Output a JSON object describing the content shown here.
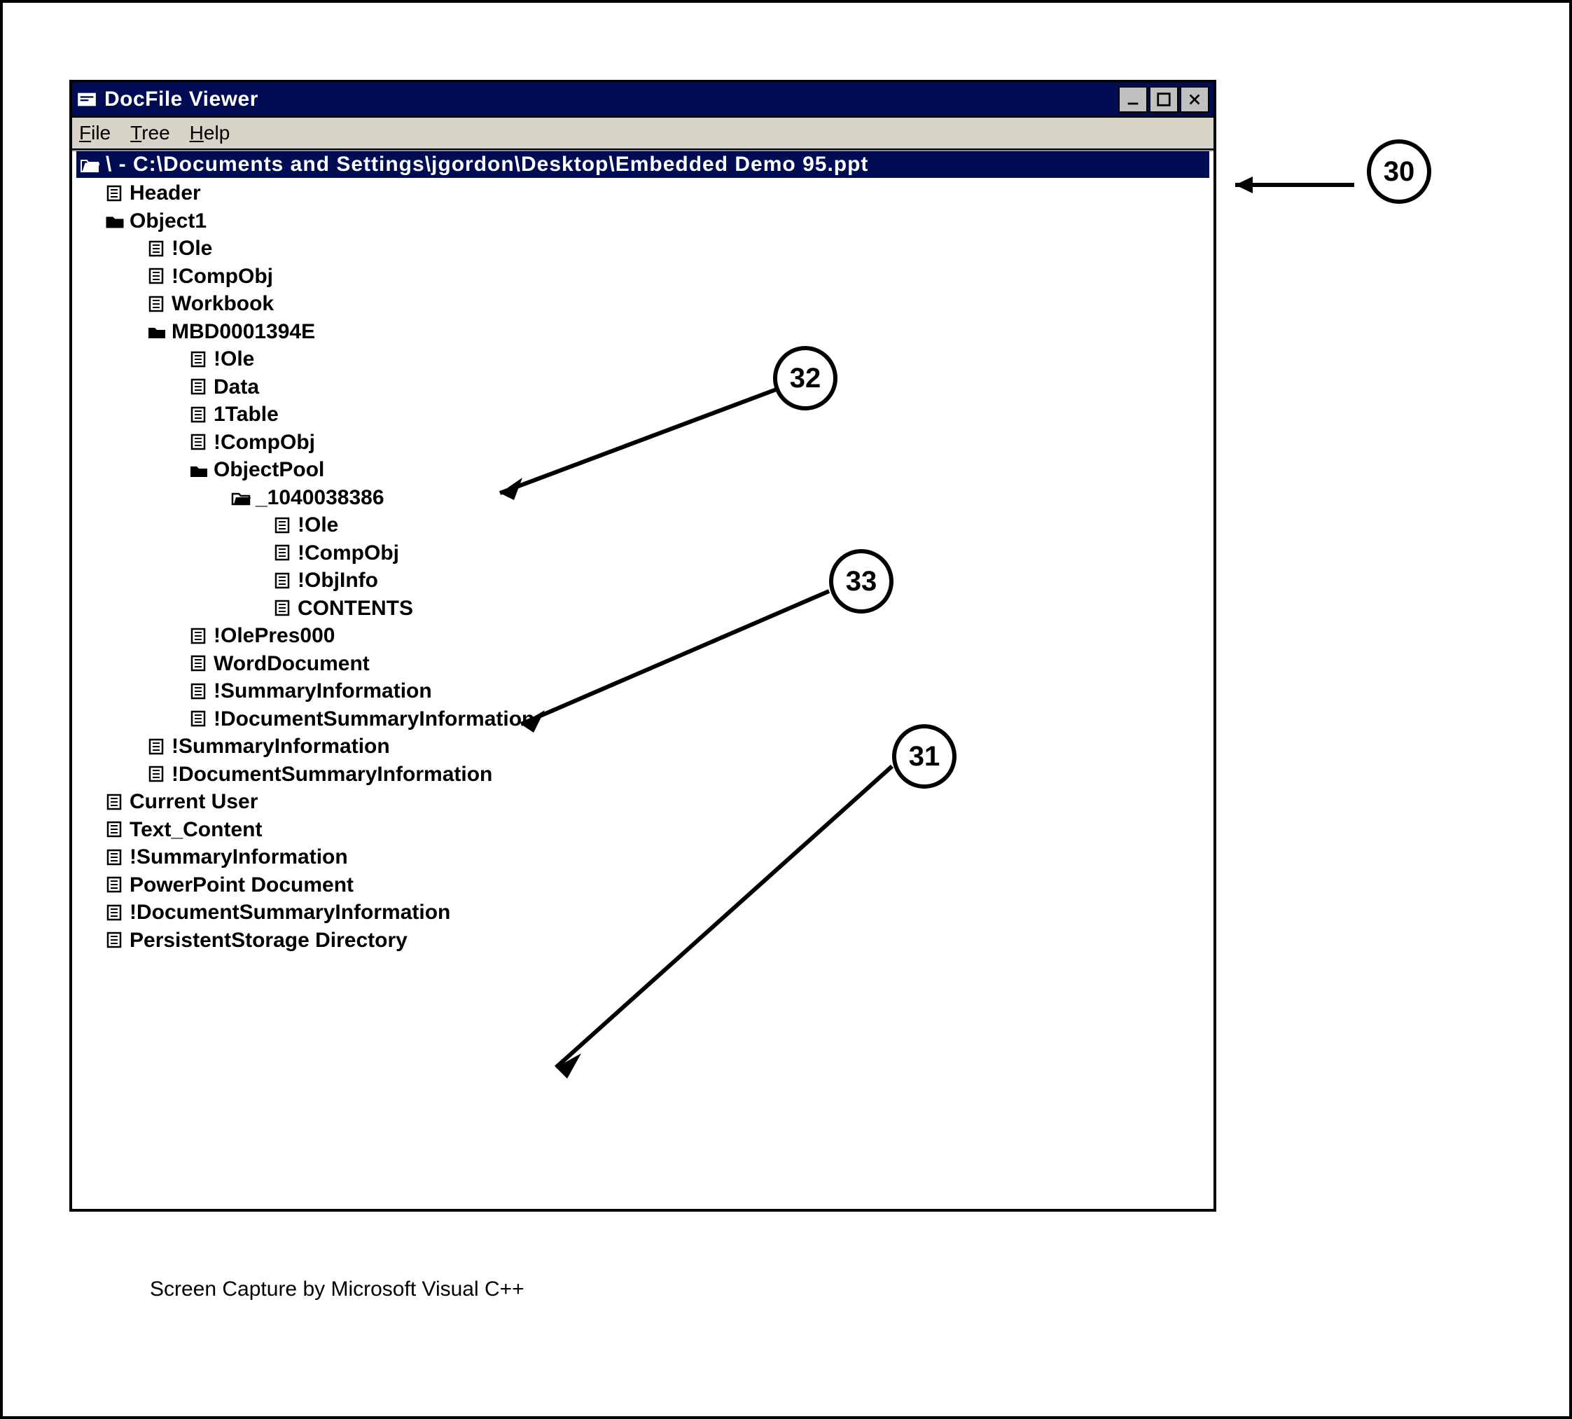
{
  "window": {
    "title": "DocFile Viewer"
  },
  "menu": {
    "file": "File",
    "tree": "Tree",
    "help": "Help"
  },
  "root": {
    "path": "\\ - C:\\Documents and Settings\\jgordon\\Desktop\\Embedded Demo 95.ppt"
  },
  "tree": {
    "n0": "Header",
    "n1": "Object1",
    "n2": "!Ole",
    "n3": "!CompObj",
    "n4": "Workbook",
    "n5": "MBD0001394E",
    "n6": "!Ole",
    "n7": "Data",
    "n8": "1Table",
    "n9": "!CompObj",
    "n10": "ObjectPool",
    "n11": "_1040038386",
    "n12": "!Ole",
    "n13": "!CompObj",
    "n14": "!ObjInfo",
    "n15": "CONTENTS",
    "n16": "!OlePres000",
    "n17": "WordDocument",
    "n18": "!SummaryInformation",
    "n19": "!DocumentSummaryInformation",
    "n20": "!SummaryInformation",
    "n21": "!DocumentSummaryInformation",
    "n22": "Current User",
    "n23": "Text_Content",
    "n24": "!SummaryInformation",
    "n25": "PowerPoint Document",
    "n26": "!DocumentSummaryInformation",
    "n27": "PersistentStorage Directory"
  },
  "caption": "Screen Capture by Microsoft Visual C++",
  "callouts": {
    "a": "30",
    "b": "31",
    "c": "32",
    "d": "33"
  }
}
